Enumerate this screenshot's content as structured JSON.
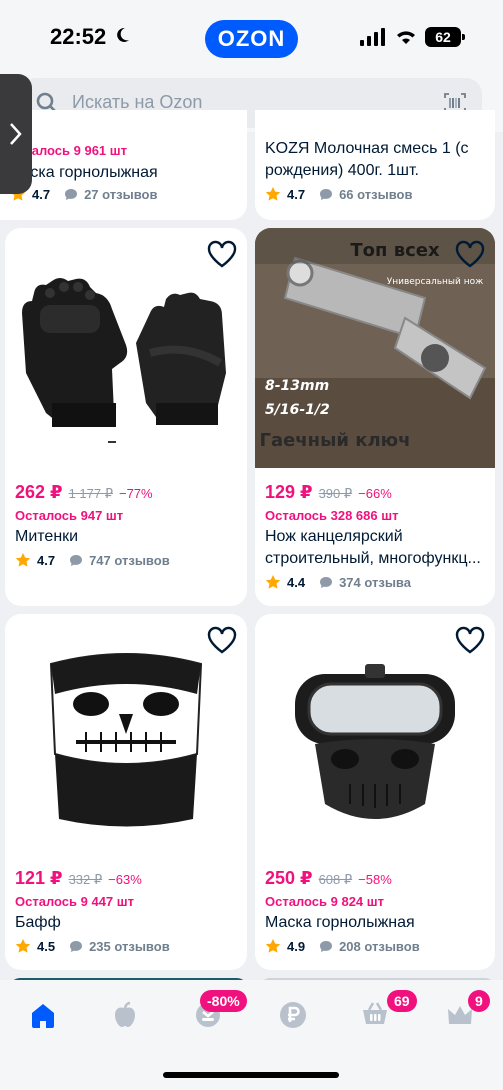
{
  "status_bar": {
    "time": "22:52",
    "brand": "OZON",
    "battery": "62"
  },
  "search": {
    "placeholder": "Искать на Ozon"
  },
  "products": [
    {
      "stock": "Осталось 9 961 шт",
      "title": "Маска горнолыжная",
      "rating": "4.7",
      "reviews": "27 отзывов"
    },
    {
      "title": "KOZЯ Молочная смесь 1 (с рождения) 400г. 1шт.",
      "rating": "4.7",
      "reviews": "66 отзывов"
    },
    {
      "price": "262 ₽",
      "old_price": "1 177 ₽",
      "discount": "−77%",
      "stock": "Осталось 947 шт",
      "title": "Митенки",
      "rating": "4.7",
      "reviews": "747 отзывов"
    },
    {
      "price": "129 ₽",
      "old_price": "390 ₽",
      "discount": "−66%",
      "stock": "Осталось 328 686 шт",
      "title": "Нож канцелярский строительный, многофункц...",
      "rating": "4.4",
      "reviews": "374 отзыва",
      "image_text": {
        "top": "Топ всех",
        "knife": "Универсальный нож",
        "size1": "8-13mm",
        "size2": "5/16-1/2",
        "bottom": "Гаечный ключ"
      }
    },
    {
      "price": "121 ₽",
      "old_price": "332 ₽",
      "discount": "−63%",
      "stock": "Осталось 9 447 шт",
      "title": "Бафф",
      "rating": "4.5",
      "reviews": "235 отзывов"
    },
    {
      "price": "250 ₽",
      "old_price": "608 ₽",
      "discount": "−58%",
      "stock": "Осталось 9 824 шт",
      "title": "Маска горнолыжная",
      "rating": "4.9",
      "reviews": "208 отзывов"
    }
  ],
  "nav": {
    "discount_badge": "-80%",
    "cart_badge": "69",
    "profile_badge": "9"
  },
  "colors": {
    "accent": "#005bff",
    "price": "#f1117e",
    "star": "#ffa800"
  }
}
